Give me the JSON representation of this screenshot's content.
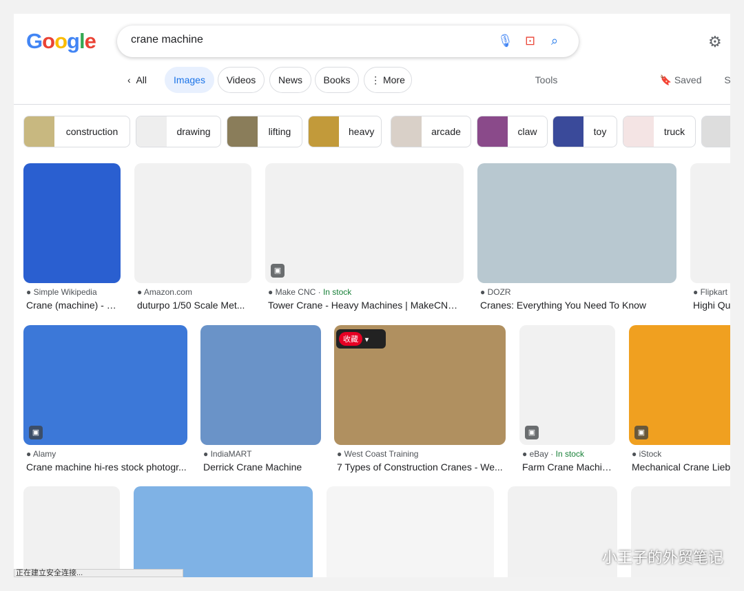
{
  "header": {
    "logo": "Google",
    "query": "crane machine",
    "saved": "Saved",
    "settings_partial": "S"
  },
  "tabs": {
    "all": "All",
    "images": "Images",
    "videos": "Videos",
    "news": "News",
    "books": "Books",
    "more": "More",
    "tools": "Tools"
  },
  "chips": [
    {
      "label": "construction",
      "color": "#c8b880"
    },
    {
      "label": "drawing",
      "color": "#eeeeee"
    },
    {
      "label": "lifting",
      "color": "#8a7d5a"
    },
    {
      "label": "heavy",
      "color": "#c29a3a"
    },
    {
      "label": "arcade",
      "color": "#d9d0c8"
    },
    {
      "label": "claw",
      "color": "#8a4a8a"
    },
    {
      "label": "toy",
      "color": "#3a4a9a"
    },
    {
      "label": "truck",
      "color": "#f4e4e4"
    },
    {
      "label": "",
      "color": "#dddddd"
    }
  ],
  "results": [
    {
      "source": "Simple Wikipedia",
      "title": "Crane (machine) - S...",
      "color": "#2a5fd0"
    },
    {
      "source": "Amazon.com",
      "title": "duturpo 1/50 Scale Met...",
      "color": "#f1f1f1"
    },
    {
      "source": "Make CNC",
      "stock": "In stock",
      "title": "Tower Crane - Heavy Machines | MakeCNC....",
      "color": "#f1f1f1"
    },
    {
      "source": "DOZR",
      "title": "Cranes: Everything You Need To Know",
      "color": "#b8c8d0"
    },
    {
      "source": "Flipkart",
      "title": "Highi Qua",
      "color": "#f1f1f1"
    },
    {
      "source": "Alamy",
      "title": "Crane machine hi-res stock photogr...",
      "color": "#3c78d8"
    },
    {
      "source": "IndiaMART",
      "title": "Derrick Crane Machine",
      "color": "#6a93c8"
    },
    {
      "source": "West Coast Training",
      "title": "7 Types of Construction Cranes - We...",
      "color": "#b09060"
    },
    {
      "source": "eBay",
      "stock": "In stock",
      "title": "Farm Crane Machin...",
      "color": "#f1f1f1"
    },
    {
      "source": "iStock",
      "title": "Mechanical Crane Liebh",
      "color": "#f0a020"
    },
    {
      "color": "#f1f1f1"
    },
    {
      "color": "#7fb2e5"
    },
    {
      "color": "#f5f5f5"
    },
    {
      "color": "#f1f1f1"
    },
    {
      "color": "#f1f1f1"
    }
  ],
  "pin_label": "收藏",
  "status": "正在建立安全连接...",
  "watermark": "小王子的外贸笔记"
}
